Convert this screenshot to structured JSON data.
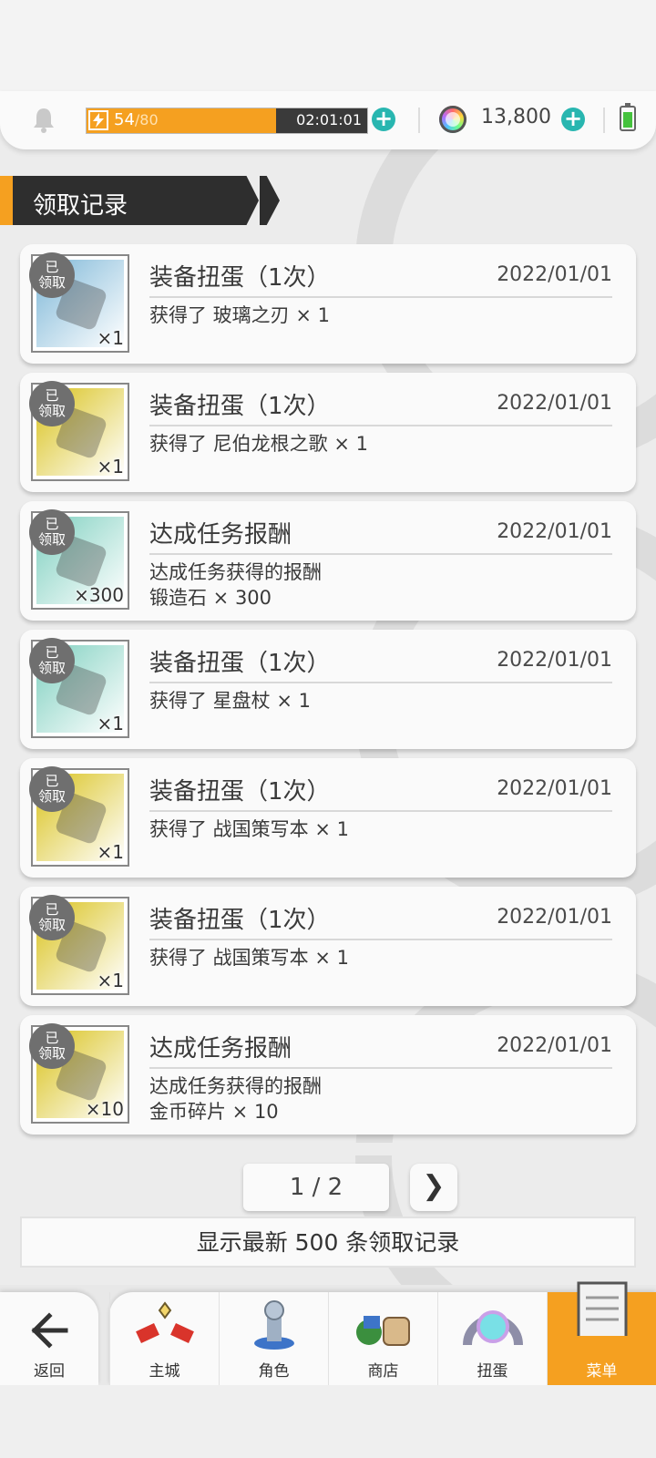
{
  "status_bar": {
    "stamina_current": "54",
    "stamina_max": "/80",
    "stamina_fraction": 0.675,
    "timer": "02:01:01",
    "currency": "13,800",
    "icons": [
      "bell-icon",
      "bolt-icon",
      "plus-icon",
      "gem-icon",
      "battery-icon"
    ]
  },
  "section": {
    "title": "领取记录"
  },
  "records": [
    {
      "badge": "已\n领取",
      "qty": "×1",
      "title": "装备扭蛋（1次）",
      "date": "2022/01/01",
      "desc": [
        "获得了 玻璃之刃 × 1"
      ],
      "item": "glass-blade-icon",
      "bg": "#7fb8d8"
    },
    {
      "badge": "已\n领取",
      "qty": "×1",
      "title": "装备扭蛋（1次）",
      "date": "2022/01/01",
      "desc": [
        "获得了 尼伯龙根之歌 × 1"
      ],
      "item": "nibelungen-book-icon",
      "bg": "#d9c21c"
    },
    {
      "badge": "已\n领取",
      "qty": "×300",
      "title": "达成任务报酬",
      "date": "2022/01/01",
      "desc": [
        "达成任务获得的报酬",
        "锻造石 × 300"
      ],
      "item": "forge-stone-icon",
      "bg": "#7fd0c0"
    },
    {
      "badge": "已\n领取",
      "qty": "×1",
      "title": "装备扭蛋（1次）",
      "date": "2022/01/01",
      "desc": [
        "获得了 星盘杖 × 1"
      ],
      "item": "astrolabe-staff-icon",
      "bg": "#7fd0c0"
    },
    {
      "badge": "已\n领取",
      "qty": "×1",
      "title": "装备扭蛋（1次）",
      "date": "2022/01/01",
      "desc": [
        "获得了 战国策写本 × 1"
      ],
      "item": "scroll-book-icon",
      "bg": "#d9c21c"
    },
    {
      "badge": "已\n领取",
      "qty": "×1",
      "title": "装备扭蛋（1次）",
      "date": "2022/01/01",
      "desc": [
        "获得了 战国策写本 × 1"
      ],
      "item": "scroll-book-icon",
      "bg": "#d9c21c"
    },
    {
      "badge": "已\n领取",
      "qty": "×10",
      "title": "达成任务报酬",
      "date": "2022/01/01",
      "desc": [
        "达成任务获得的报酬",
        "金币碎片 × 10"
      ],
      "item": "coin-fragment-icon",
      "bg": "#d9c21c"
    }
  ],
  "pager": {
    "text": "1 / 2",
    "next": "❯"
  },
  "notice": "显示最新 500 条领取记录",
  "nav": {
    "back": {
      "label": "返回"
    },
    "items": [
      {
        "label": "主城",
        "icon": "castle-icon",
        "active": false
      },
      {
        "label": "角色",
        "icon": "character-icon",
        "active": false
      },
      {
        "label": "商店",
        "icon": "shop-icon",
        "active": false
      },
      {
        "label": "扭蛋",
        "icon": "gacha-icon",
        "active": false
      },
      {
        "label": "菜单",
        "icon": "menu-icon",
        "active": true
      }
    ],
    "active_color": "#f5a020"
  }
}
